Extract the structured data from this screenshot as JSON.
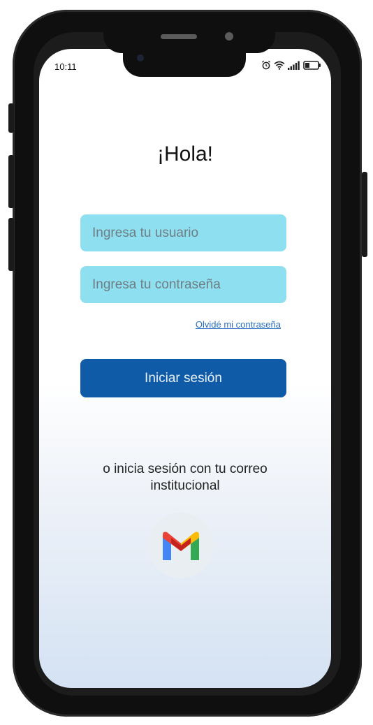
{
  "status_bar": {
    "time": "10:11"
  },
  "login": {
    "greeting": "¡Hola!",
    "username_placeholder": "Ingresa tu usuario",
    "password_placeholder": "Ingresa tu contraseña",
    "forgot_password": "Olvidé mi contraseña",
    "submit_label": "Iniciar sesión",
    "alt_login_text": "o inicia sesión con tu correo institucional"
  },
  "icons": [
    "alarm-icon",
    "wifi-icon",
    "signal-icon",
    "battery-icon",
    "gmail-icon"
  ],
  "colors": {
    "input_bg": "#8edff0",
    "primary_button": "#0f5ba8",
    "link": "#2a6fc2"
  }
}
